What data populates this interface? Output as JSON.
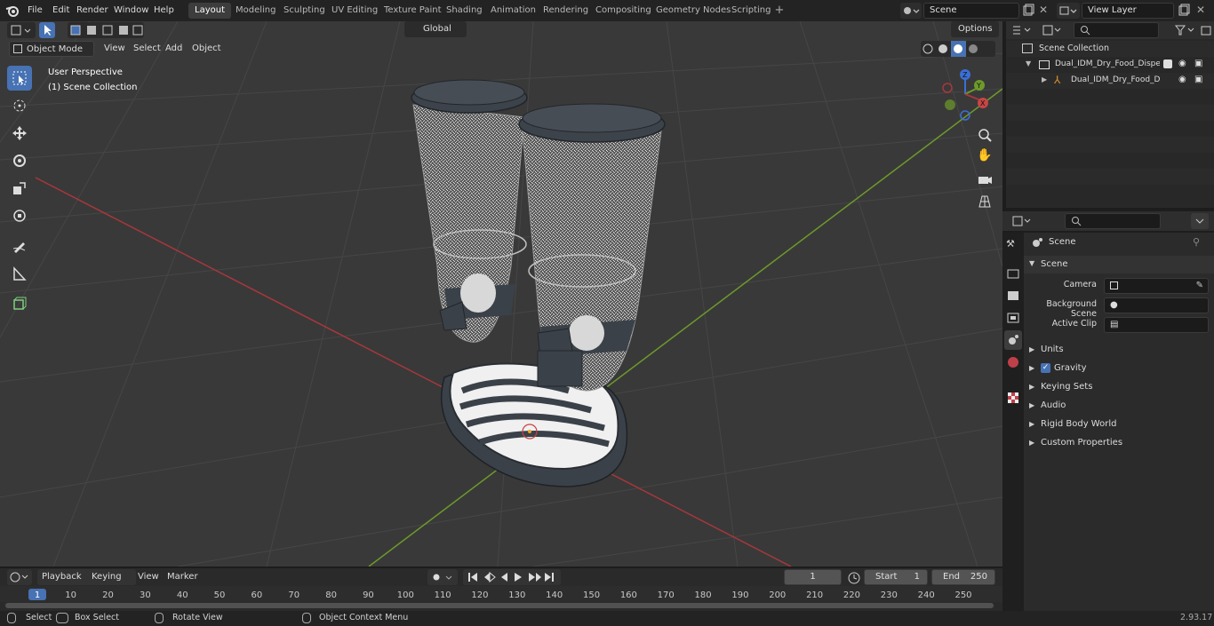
{
  "topbar": {
    "menus": [
      "File",
      "Edit",
      "Render",
      "Window",
      "Help"
    ],
    "workspaces": [
      "Layout",
      "Modeling",
      "Sculpting",
      "UV Editing",
      "Texture Paint",
      "Shading",
      "Animation",
      "Rendering",
      "Compositing",
      "Geometry Nodes",
      "Scripting"
    ],
    "active_workspace": "Layout",
    "scene_name": "Scene",
    "view_layer": "View Layer"
  },
  "viewport": {
    "mode": "Object Mode",
    "menus": [
      "View",
      "Select",
      "Add",
      "Object"
    ],
    "transform_orientation": "Global",
    "options_label": "Options",
    "perspective_label": "User Perspective",
    "collection_label": "(1) Scene Collection",
    "gizmo_axes": [
      "X",
      "Y",
      "Z"
    ]
  },
  "outliner": {
    "root": "Scene Collection",
    "items": [
      {
        "label": "Dual_IDM_Dry_Food_Dispense"
      },
      {
        "label": "Dual_IDM_Dry_Food_Disp"
      }
    ]
  },
  "properties": {
    "context_title": "Scene",
    "section": "Scene",
    "fields": [
      {
        "label": "Camera",
        "value": ""
      },
      {
        "label": "Background Scene",
        "value": ""
      },
      {
        "label": "Active Clip",
        "value": ""
      }
    ],
    "panels": [
      "Units",
      "Gravity",
      "Keying Sets",
      "Audio",
      "Rigid Body World",
      "Custom Properties"
    ],
    "gravity_checked": true
  },
  "timeline": {
    "menus": [
      "Playback",
      "Keying",
      "View",
      "Marker"
    ],
    "current_frame": "1",
    "start_label": "Start",
    "start_value": "1",
    "end_label": "End",
    "end_value": "250",
    "ticks": [
      "1",
      "10",
      "20",
      "30",
      "40",
      "50",
      "60",
      "70",
      "80",
      "90",
      "100",
      "110",
      "120",
      "130",
      "140",
      "150",
      "160",
      "170",
      "180",
      "190",
      "200",
      "210",
      "220",
      "230",
      "240",
      "250"
    ]
  },
  "statusbar": {
    "select": "Select",
    "box_select": "Box Select",
    "rotate_view": "Rotate View",
    "context_menu": "Object Context Menu",
    "version": "2.93.17"
  },
  "colors": {
    "accent": "#4772b3",
    "x_axis": "#a8373c",
    "y_axis": "#6d9a2b",
    "viewport_bg": "#393939"
  }
}
